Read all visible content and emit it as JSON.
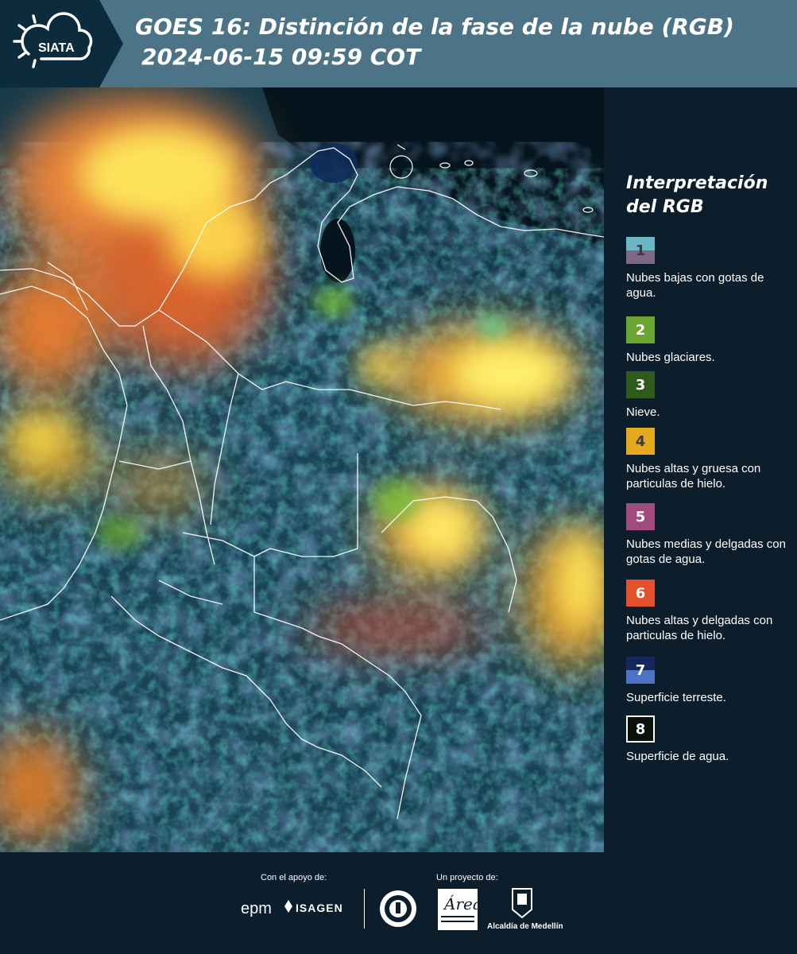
{
  "header": {
    "logo_text": "SIATA",
    "title": "GOES 16: Distinción de la fase de la nube (RGB)",
    "subtitle": "2024-06-15 09:59 COT"
  },
  "legend": {
    "title_line1": "Interpretación",
    "title_line2": "del RGB",
    "items": [
      {
        "number": "1",
        "label": "Nubes bajas con gotas de agua.",
        "color_top": "#6bb7c6",
        "color_bottom": "#7a6a87",
        "text_color": "#3c3c3c"
      },
      {
        "number": "2",
        "label": "Nubes glaciares.",
        "color_top": "#6aa530",
        "color_bottom": "#6aa530",
        "text_color": "#ffffff"
      },
      {
        "number": "3",
        "label": "Nieve.",
        "color_top": "#2e5a1c",
        "color_bottom": "#2e5a1c",
        "text_color": "#ffffff"
      },
      {
        "number": "4",
        "label": "Nubes altas y gruesa con particulas de hielo.",
        "color_top": "#e5a91e",
        "color_bottom": "#e5a91e",
        "text_color": "#3c3c3c"
      },
      {
        "number": "5",
        "label": "Nubes medias y delgadas con gotas de agua.",
        "color_top": "#a04a7e",
        "color_bottom": "#a04a7e",
        "text_color": "#ffffff"
      },
      {
        "number": "6",
        "label": "Nubes altas y delgadas con particulas de hielo.",
        "color_top": "#e2512c",
        "color_bottom": "#e2512c",
        "text_color": "#ffffff"
      },
      {
        "number": "7",
        "label": "Superficie terreste.",
        "color_top": "#14285e",
        "color_bottom": "#4e72c4",
        "text_color": "#ffffff"
      },
      {
        "number": "8",
        "label": "Superficie de agua.",
        "color_top": "#0b120b",
        "color_bottom": "#0b120b",
        "text_color": "#ffffff",
        "border": "#ffffff"
      }
    ]
  },
  "footer": {
    "support_label": "Con el apoyo de:",
    "project_label": "Un proyecto de:",
    "epm_text": "epm",
    "isagen_text": "ISAGEN",
    "alcaldia_text": "Alcaldía de Medellín"
  },
  "colors": {
    "header_bg": "#4c7486",
    "logo_bg": "#0c2b3c",
    "panel_bg": "#0c1d2b"
  }
}
